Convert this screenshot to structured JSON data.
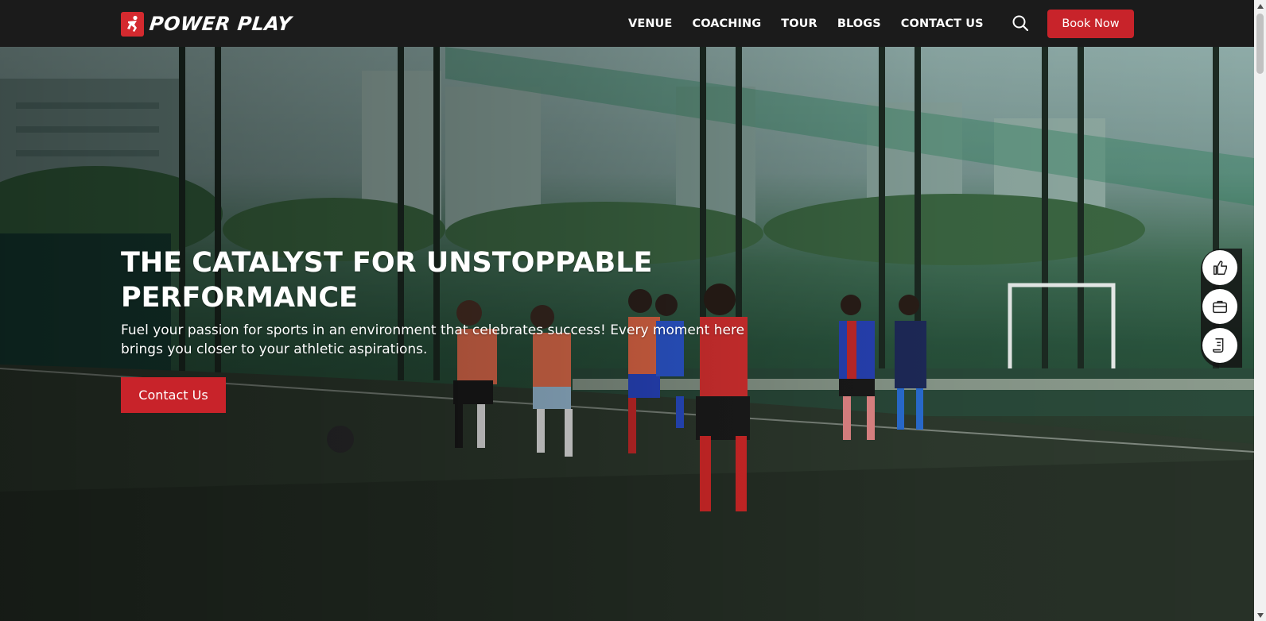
{
  "brand": {
    "name": "POWER PLAY",
    "accent_color": "#c8232a",
    "logo_icon": "runner-logo-icon"
  },
  "nav": {
    "items": [
      {
        "label": "VENUE"
      },
      {
        "label": "COACHING"
      },
      {
        "label": "TOUR"
      },
      {
        "label": "BLOGS"
      },
      {
        "label": "CONTACT US"
      }
    ],
    "search_icon": "search-icon",
    "book_label": "Book Now"
  },
  "hero": {
    "title": "THE CATALYST FOR UNSTOPPABLE PERFORMANCE",
    "subtitle": "Fuel your passion for sports in an environment that celebrates success! Every moment here brings you closer to your athletic aspirations.",
    "cta_label": "Contact Us",
    "background": "photo of children playing football on an artificial turf pitch enclosed by green nets"
  },
  "floating_actions": [
    {
      "icon": "thumbs-up-icon"
    },
    {
      "icon": "briefcase-icon"
    },
    {
      "icon": "document-icon"
    }
  ]
}
